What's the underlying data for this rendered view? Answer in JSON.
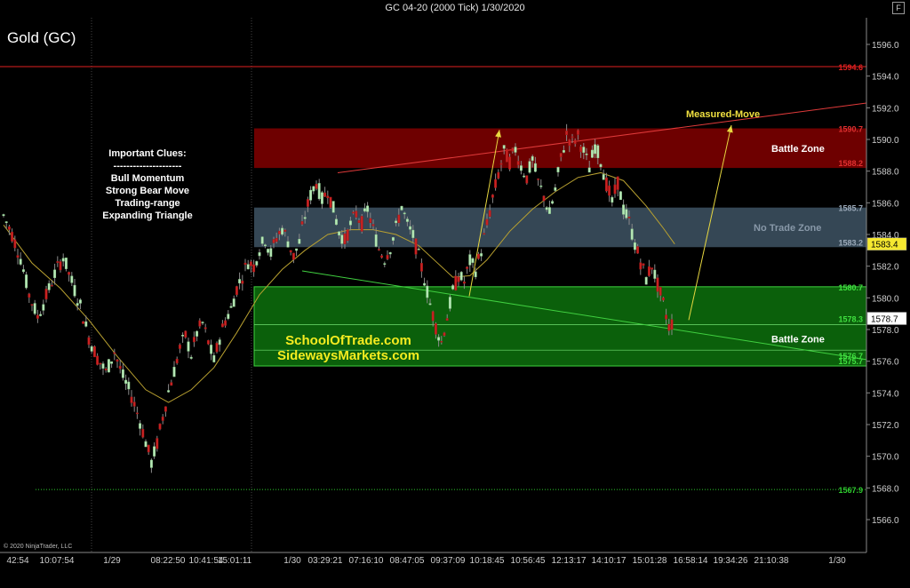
{
  "window": {
    "title": "GC 04-20 (2000 Tick)  1/30/2020",
    "f_button": "F",
    "scroll_button": "▷|"
  },
  "chart_data": {
    "type": "candlestick",
    "title": "Gold (GC)",
    "copyright": "© 2020 NinjaTrader, LLC",
    "ylim": [
      1564,
      1598
    ],
    "y_ticks": [
      1566,
      1568,
      1570,
      1572,
      1574,
      1576,
      1578,
      1580,
      1582,
      1584,
      1586,
      1588,
      1590,
      1592,
      1594,
      1596
    ],
    "x_tick_labels": [
      "42:54",
      "10:07:54",
      "1/29",
      "08:22:50",
      "10:41:54",
      "15:01:11",
      "1/30",
      "03:29:21",
      "07:16:10",
      "08:47:05",
      "09:37:09",
      "10:18:45",
      "10:56:45",
      "12:13:17",
      "14:10:17",
      "15:01:28",
      "16:58:14",
      "19:34:26",
      "21:10:38",
      "1/30"
    ],
    "last_price": "1578.7",
    "sma_price": "1583.4",
    "price_lines": [
      {
        "value": 1594.6,
        "label": "1594.6",
        "color": "#e02020"
      },
      {
        "value": 1567.9,
        "label": "1567.9",
        "color": "#2ecc2e"
      }
    ],
    "zones": [
      {
        "name": "Battle Zone",
        "top": 1590.7,
        "bottom": 1588.2,
        "top_label": "1590.7",
        "bottom_label": "1588.2",
        "fill": "#7a0000",
        "label_color": "#e03030"
      },
      {
        "name": "No Trade Zone",
        "top": 1585.7,
        "bottom": 1583.2,
        "top_label": "1585.7",
        "bottom_label": "1583.2",
        "fill": "#3b4f5e",
        "label_color": "#9aa8b8"
      },
      {
        "name": "Battle Zone",
        "top": 1580.7,
        "bottom": 1575.7,
        "top_label": "1580.7",
        "bottom_label": "1575.7",
        "fill": "#0c6a0c",
        "label_color": "#40e040"
      }
    ],
    "inner_zone_lines": [
      {
        "value": 1578.3,
        "label": "1578.3"
      },
      {
        "value": 1576.7,
        "label": "1576.7"
      }
    ],
    "annotations": {
      "clues_title": "Important Clues:",
      "clues_separator": "---------------------",
      "clues": [
        "Bull Momentum",
        "Strong Bear Move",
        "Trading-range",
        "Expanding Triangle"
      ],
      "measured_move": "Measured-Move",
      "website1": "SchoolOfTrade.com",
      "website2": "SidewaysMarkets.com"
    },
    "price_path": [
      [
        0,
        1585.2
      ],
      [
        3,
        1584.0
      ],
      [
        6,
        1582.5
      ],
      [
        9,
        1580.2
      ],
      [
        12,
        1578.8
      ],
      [
        15,
        1580.1
      ],
      [
        18,
        1581.5
      ],
      [
        21,
        1582.6
      ],
      [
        24,
        1581.0
      ],
      [
        27,
        1579.5
      ],
      [
        30,
        1577.5
      ],
      [
        33,
        1576.2
      ],
      [
        36,
        1575.3
      ],
      [
        39,
        1576.6
      ],
      [
        42,
        1575.0
      ],
      [
        45,
        1573.8
      ],
      [
        48,
        1572.2
      ],
      [
        50,
        1570.9
      ],
      [
        52,
        1569.6
      ],
      [
        54,
        1570.8
      ],
      [
        56,
        1572.5
      ],
      [
        58,
        1574.1
      ],
      [
        60,
        1575.4
      ],
      [
        62,
        1576.8
      ],
      [
        64,
        1577.6
      ],
      [
        66,
        1576.4
      ],
      [
        68,
        1577.8
      ],
      [
        70,
        1578.4
      ],
      [
        72,
        1577.2
      ],
      [
        74,
        1576.0
      ],
      [
        76,
        1577.5
      ],
      [
        78,
        1578.6
      ],
      [
        80,
        1579.3
      ],
      [
        82,
        1580.6
      ],
      [
        84,
        1581.4
      ],
      [
        86,
        1582.3
      ],
      [
        88,
        1582.0
      ],
      [
        90,
        1583.1
      ],
      [
        92,
        1583.7
      ],
      [
        94,
        1582.8
      ],
      [
        96,
        1583.8
      ],
      [
        98,
        1584.4
      ],
      [
        100,
        1583.6
      ],
      [
        102,
        1582.6
      ],
      [
        104,
        1583.5
      ],
      [
        106,
        1585.2
      ],
      [
        108,
        1586.5
      ],
      [
        110,
        1587.3
      ],
      [
        112,
        1586.2
      ],
      [
        114,
        1586.8
      ],
      [
        116,
        1585.6
      ],
      [
        118,
        1584.2
      ],
      [
        120,
        1583.6
      ],
      [
        122,
        1584.6
      ],
      [
        124,
        1585.3
      ],
      [
        126,
        1584.7
      ],
      [
        128,
        1585.6
      ],
      [
        130,
        1584.3
      ],
      [
        132,
        1583.1
      ],
      [
        134,
        1582.5
      ],
      [
        136,
        1583.2
      ],
      [
        138,
        1584.4
      ],
      [
        140,
        1585.8
      ],
      [
        142,
        1584.6
      ],
      [
        144,
        1583.9
      ],
      [
        146,
        1582.6
      ],
      [
        148,
        1581.2
      ],
      [
        150,
        1579.6
      ],
      [
        152,
        1578.2
      ],
      [
        154,
        1577.2
      ],
      [
        156,
        1578.8
      ],
      [
        158,
        1580.4
      ],
      [
        160,
        1581.4
      ],
      [
        162,
        1581.0
      ],
      [
        164,
        1582.3
      ],
      [
        166,
        1581.8
      ],
      [
        168,
        1583.0
      ],
      [
        170,
        1584.6
      ],
      [
        172,
        1586.3
      ],
      [
        174,
        1587.8
      ],
      [
        176,
        1589.2
      ],
      [
        178,
        1588.6
      ],
      [
        180,
        1589.4
      ],
      [
        182,
        1588.3
      ],
      [
        184,
        1587.6
      ],
      [
        186,
        1588.7
      ],
      [
        188,
        1587.3
      ],
      [
        190,
        1586.4
      ],
      [
        192,
        1585.3
      ],
      [
        194,
        1586.8
      ],
      [
        196,
        1588.8
      ],
      [
        198,
        1590.3
      ],
      [
        200,
        1589.8
      ],
      [
        202,
        1590.2
      ],
      [
        204,
        1589.2
      ],
      [
        206,
        1588.2
      ],
      [
        208,
        1589.6
      ],
      [
        210,
        1588.7
      ],
      [
        212,
        1587.2
      ],
      [
        214,
        1586.0
      ],
      [
        216,
        1587.3
      ],
      [
        218,
        1585.6
      ],
      [
        220,
        1584.8
      ],
      [
        222,
        1583.4
      ],
      [
        224,
        1582.3
      ],
      [
        226,
        1581.2
      ],
      [
        228,
        1582.1
      ],
      [
        230,
        1580.8
      ],
      [
        232,
        1579.6
      ],
      [
        234,
        1578.2
      ],
      [
        236,
        1578.6
      ]
    ],
    "sma_path": [
      [
        0,
        1584.6
      ],
      [
        10,
        1582.2
      ],
      [
        20,
        1580.6
      ],
      [
        30,
        1578.6
      ],
      [
        40,
        1576.3
      ],
      [
        50,
        1574.2
      ],
      [
        58,
        1573.4
      ],
      [
        66,
        1574.2
      ],
      [
        74,
        1575.6
      ],
      [
        82,
        1577.8
      ],
      [
        90,
        1580.2
      ],
      [
        98,
        1581.8
      ],
      [
        106,
        1583.0
      ],
      [
        114,
        1584.0
      ],
      [
        122,
        1584.3
      ],
      [
        130,
        1584.3
      ],
      [
        138,
        1584.0
      ],
      [
        146,
        1583.3
      ],
      [
        152,
        1582.3
      ],
      [
        158,
        1581.3
      ],
      [
        164,
        1581.4
      ],
      [
        170,
        1582.4
      ],
      [
        178,
        1584.2
      ],
      [
        186,
        1585.6
      ],
      [
        194,
        1586.7
      ],
      [
        202,
        1587.6
      ],
      [
        210,
        1587.9
      ],
      [
        218,
        1587.4
      ],
      [
        226,
        1585.8
      ],
      [
        232,
        1584.4
      ],
      [
        236,
        1583.4
      ]
    ]
  }
}
